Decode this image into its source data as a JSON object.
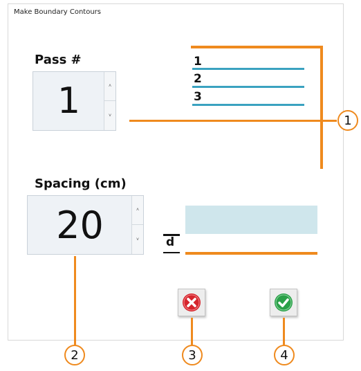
{
  "window": {
    "title": "Make Boundary Contours"
  },
  "pass": {
    "label": "Pass #",
    "value": "1"
  },
  "spacing": {
    "label": "Spacing (cm)",
    "value": "20"
  },
  "spinner": {
    "up": "˄",
    "down": "˅"
  },
  "diagram": {
    "line_numbers": [
      "1",
      "2",
      "3"
    ],
    "spacing_symbol": "d"
  },
  "callouts": [
    "1",
    "2",
    "3",
    "4"
  ],
  "buttons": {
    "cancel_icon": "x-circle-icon",
    "ok_icon": "check-circle-icon"
  },
  "colors": {
    "accent": "#ef8a1e",
    "contour": "#3aa2c0",
    "band": "#cfe6ec",
    "cancel": "#d6252d",
    "ok": "#2aa048"
  }
}
